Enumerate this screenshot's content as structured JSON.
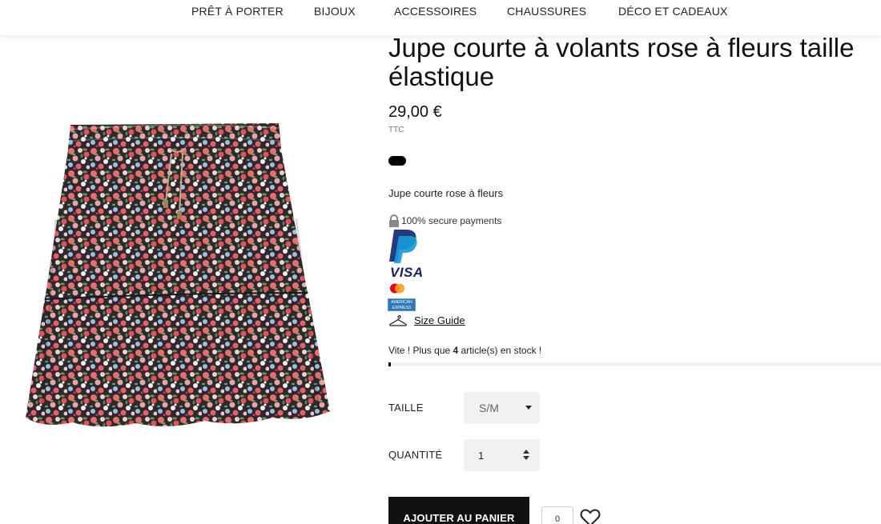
{
  "nav": {
    "items": [
      "PRÊT À PORTER",
      "BIJOUX",
      "ACCESSOIRES",
      "CHAUSSURES",
      "DÉCO ET CADEAUX"
    ]
  },
  "product": {
    "title_line1": "Jupe courte à volants rose à fleurs taille",
    "title_line2": "élastique",
    "price": "29,00 €",
    "tax_label": "TTC",
    "short_description": "Jupe courte rose à fleurs",
    "swatch_color": "#000000"
  },
  "payments": {
    "secure_label": "100% secure payments",
    "visa_label": "VISA",
    "amex_label": "AMERICAN EXPRESS"
  },
  "size_guide": {
    "label": "Size Guide"
  },
  "stock": {
    "prefix": "Vite ! Plus que",
    "count": "4",
    "suffix": "article(s) en stock !",
    "level": 0.005
  },
  "options": {
    "size_label": "TAILLE",
    "size_value": "S/M",
    "quantity_label": "QUANTITÉ",
    "quantity_value": "1"
  },
  "cart": {
    "add_label": "AJOUTER AU PANIER",
    "wishlist_count": "0"
  },
  "colors": {
    "accent": "#111111",
    "paypal_dark": "#253b80",
    "paypal_light": "#179bd7",
    "visa": "#1a1f71",
    "amex": "#2e77bb"
  }
}
